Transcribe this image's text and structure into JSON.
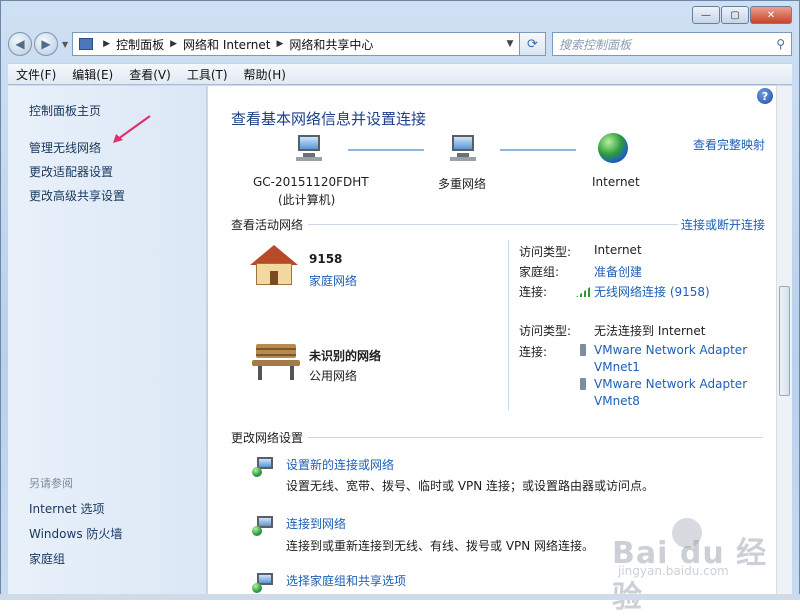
{
  "window": {
    "controls": {
      "minimize": "—",
      "maximize": "▢",
      "close": "✕"
    }
  },
  "address": {
    "crumbs": [
      "控制面板",
      "网络和 Internet",
      "网络和共享中心"
    ],
    "search_placeholder": "搜索控制面板"
  },
  "menu": [
    "文件(F)",
    "编辑(E)",
    "查看(V)",
    "工具(T)",
    "帮助(H)"
  ],
  "sidebar": {
    "links": [
      "控制面板主页",
      "管理无线网络",
      "更改适配器设置",
      "更改高级共享设置"
    ],
    "see_also": "另请参阅",
    "see_also_links": [
      "Internet 选项",
      "Windows 防火墙",
      "家庭组"
    ]
  },
  "main": {
    "title": "查看基本网络信息并设置连接",
    "view_full_map": "查看完整映射",
    "map": {
      "computer_name": "GC-20151120FDHT",
      "computer_sub": "(此计算机)",
      "middle": "多重网络",
      "internet": "Internet"
    },
    "active_header": "查看活动网络",
    "connect_disconnect": "连接或断开连接",
    "networks": [
      {
        "name": "9158",
        "type": "家庭网络",
        "access_label": "访问类型:",
        "access_value": "Internet",
        "homegroup_label": "家庭组:",
        "homegroup_value": "准备创建",
        "conn_label": "连接:",
        "conn_value": "无线网络连接 (9158)"
      },
      {
        "name": "未识别的网络",
        "type": "公用网络",
        "access_label": "访问类型:",
        "access_value": "无法连接到 Internet",
        "conn_label": "连接:",
        "conn_value_1a": "VMware Network Adapter",
        "conn_value_1b": "VMnet1",
        "conn_value_2a": "VMware Network Adapter",
        "conn_value_2b": "VMnet8"
      }
    ],
    "change_header": "更改网络设置",
    "tasks": [
      {
        "title": "设置新的连接或网络",
        "desc": "设置无线、宽带、拨号、临时或 VPN 连接；或设置路由器或访问点。"
      },
      {
        "title": "连接到网络",
        "desc": "连接到或重新连接到无线、有线、拨号或 VPN 网络连接。"
      },
      {
        "title": "选择家庭组和共享选项",
        "desc": ""
      }
    ]
  },
  "watermark": {
    "main": "Bai du 经验",
    "sub": "jingyan.baidu.com"
  },
  "colors": {
    "link": "#1d5fb6",
    "title": "#1e3f8a",
    "sidebar_text": "#17365d",
    "arrow": "#e0306a"
  }
}
